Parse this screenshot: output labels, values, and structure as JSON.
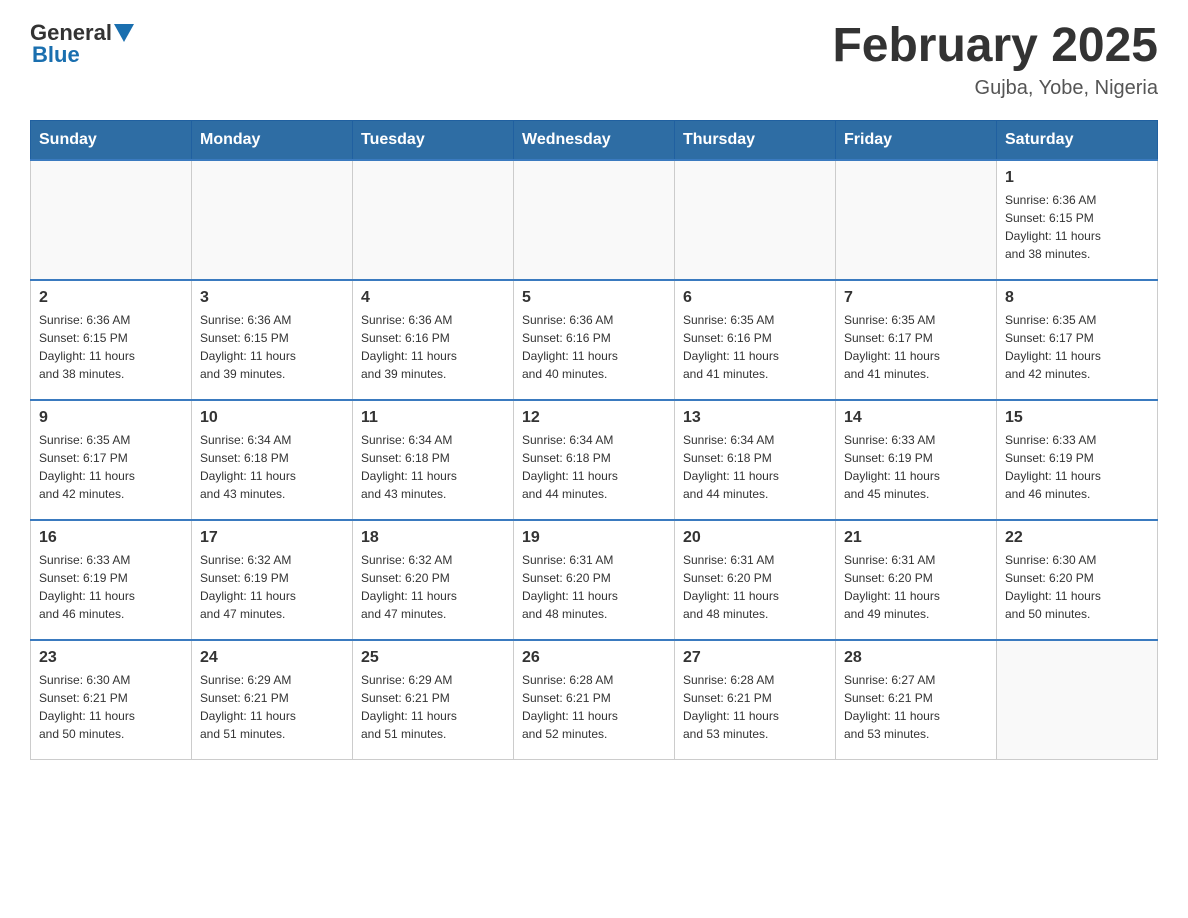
{
  "header": {
    "logo_general": "General",
    "logo_blue": "Blue",
    "title": "February 2025",
    "subtitle": "Gujba, Yobe, Nigeria"
  },
  "weekdays": [
    "Sunday",
    "Monday",
    "Tuesday",
    "Wednesday",
    "Thursday",
    "Friday",
    "Saturday"
  ],
  "weeks": [
    [
      {
        "day": "",
        "info": ""
      },
      {
        "day": "",
        "info": ""
      },
      {
        "day": "",
        "info": ""
      },
      {
        "day": "",
        "info": ""
      },
      {
        "day": "",
        "info": ""
      },
      {
        "day": "",
        "info": ""
      },
      {
        "day": "1",
        "info": "Sunrise: 6:36 AM\nSunset: 6:15 PM\nDaylight: 11 hours\nand 38 minutes."
      }
    ],
    [
      {
        "day": "2",
        "info": "Sunrise: 6:36 AM\nSunset: 6:15 PM\nDaylight: 11 hours\nand 38 minutes."
      },
      {
        "day": "3",
        "info": "Sunrise: 6:36 AM\nSunset: 6:15 PM\nDaylight: 11 hours\nand 39 minutes."
      },
      {
        "day": "4",
        "info": "Sunrise: 6:36 AM\nSunset: 6:16 PM\nDaylight: 11 hours\nand 39 minutes."
      },
      {
        "day": "5",
        "info": "Sunrise: 6:36 AM\nSunset: 6:16 PM\nDaylight: 11 hours\nand 40 minutes."
      },
      {
        "day": "6",
        "info": "Sunrise: 6:35 AM\nSunset: 6:16 PM\nDaylight: 11 hours\nand 41 minutes."
      },
      {
        "day": "7",
        "info": "Sunrise: 6:35 AM\nSunset: 6:17 PM\nDaylight: 11 hours\nand 41 minutes."
      },
      {
        "day": "8",
        "info": "Sunrise: 6:35 AM\nSunset: 6:17 PM\nDaylight: 11 hours\nand 42 minutes."
      }
    ],
    [
      {
        "day": "9",
        "info": "Sunrise: 6:35 AM\nSunset: 6:17 PM\nDaylight: 11 hours\nand 42 minutes."
      },
      {
        "day": "10",
        "info": "Sunrise: 6:34 AM\nSunset: 6:18 PM\nDaylight: 11 hours\nand 43 minutes."
      },
      {
        "day": "11",
        "info": "Sunrise: 6:34 AM\nSunset: 6:18 PM\nDaylight: 11 hours\nand 43 minutes."
      },
      {
        "day": "12",
        "info": "Sunrise: 6:34 AM\nSunset: 6:18 PM\nDaylight: 11 hours\nand 44 minutes."
      },
      {
        "day": "13",
        "info": "Sunrise: 6:34 AM\nSunset: 6:18 PM\nDaylight: 11 hours\nand 44 minutes."
      },
      {
        "day": "14",
        "info": "Sunrise: 6:33 AM\nSunset: 6:19 PM\nDaylight: 11 hours\nand 45 minutes."
      },
      {
        "day": "15",
        "info": "Sunrise: 6:33 AM\nSunset: 6:19 PM\nDaylight: 11 hours\nand 46 minutes."
      }
    ],
    [
      {
        "day": "16",
        "info": "Sunrise: 6:33 AM\nSunset: 6:19 PM\nDaylight: 11 hours\nand 46 minutes."
      },
      {
        "day": "17",
        "info": "Sunrise: 6:32 AM\nSunset: 6:19 PM\nDaylight: 11 hours\nand 47 minutes."
      },
      {
        "day": "18",
        "info": "Sunrise: 6:32 AM\nSunset: 6:20 PM\nDaylight: 11 hours\nand 47 minutes."
      },
      {
        "day": "19",
        "info": "Sunrise: 6:31 AM\nSunset: 6:20 PM\nDaylight: 11 hours\nand 48 minutes."
      },
      {
        "day": "20",
        "info": "Sunrise: 6:31 AM\nSunset: 6:20 PM\nDaylight: 11 hours\nand 48 minutes."
      },
      {
        "day": "21",
        "info": "Sunrise: 6:31 AM\nSunset: 6:20 PM\nDaylight: 11 hours\nand 49 minutes."
      },
      {
        "day": "22",
        "info": "Sunrise: 6:30 AM\nSunset: 6:20 PM\nDaylight: 11 hours\nand 50 minutes."
      }
    ],
    [
      {
        "day": "23",
        "info": "Sunrise: 6:30 AM\nSunset: 6:21 PM\nDaylight: 11 hours\nand 50 minutes."
      },
      {
        "day": "24",
        "info": "Sunrise: 6:29 AM\nSunset: 6:21 PM\nDaylight: 11 hours\nand 51 minutes."
      },
      {
        "day": "25",
        "info": "Sunrise: 6:29 AM\nSunset: 6:21 PM\nDaylight: 11 hours\nand 51 minutes."
      },
      {
        "day": "26",
        "info": "Sunrise: 6:28 AM\nSunset: 6:21 PM\nDaylight: 11 hours\nand 52 minutes."
      },
      {
        "day": "27",
        "info": "Sunrise: 6:28 AM\nSunset: 6:21 PM\nDaylight: 11 hours\nand 53 minutes."
      },
      {
        "day": "28",
        "info": "Sunrise: 6:27 AM\nSunset: 6:21 PM\nDaylight: 11 hours\nand 53 minutes."
      },
      {
        "day": "",
        "info": ""
      }
    ]
  ]
}
